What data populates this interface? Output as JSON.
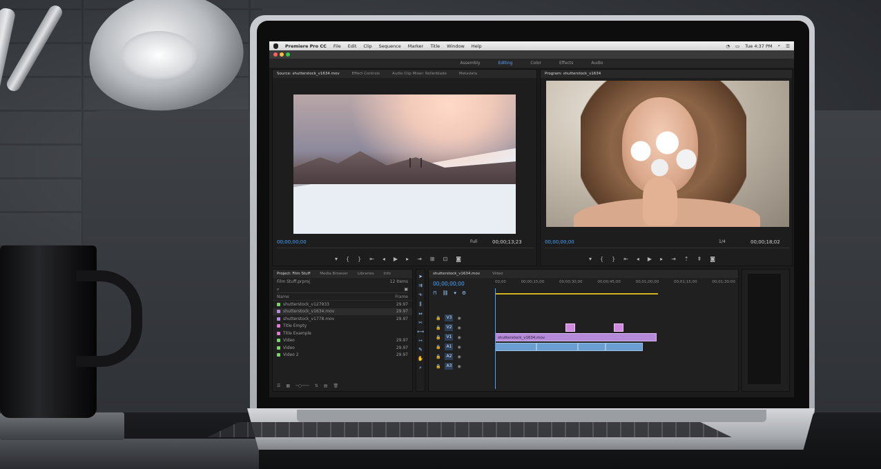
{
  "menubar": {
    "app": "Premiere Pro CC",
    "items": [
      "File",
      "Edit",
      "Clip",
      "Sequence",
      "Marker",
      "Title",
      "Window",
      "Help"
    ],
    "clock": "Tue 4:37 PM"
  },
  "workspaces": {
    "items": [
      "Assembly",
      "Editing",
      "Color",
      "Effects",
      "Audio"
    ],
    "active": "Editing"
  },
  "source": {
    "tabs": [
      "Source: shutterstock_v1634.mov",
      "Effect Controls",
      "Audio Clip Mixer: Rollerblade",
      "Metadata"
    ],
    "timecode_in": "00;00;00;00",
    "fit": "Full",
    "timecode_dur": "00;00;13;23"
  },
  "program": {
    "tab": "Program: shutterstock_v1634",
    "timecode_in": "00;00;00;00",
    "fit": "1/4",
    "timecode_dur": "00;00;18;02"
  },
  "project": {
    "tabs": [
      "Project: Film Stuff",
      "Media Browser",
      "Libraries",
      "Info"
    ],
    "subtitle": "Film Stuff.prproj",
    "item_count": "12 Items",
    "head_name": "Name",
    "head_rate": "Frame",
    "items": [
      {
        "name": "shutterstock_v127933",
        "rate": "29.97",
        "color": "#7bd36a"
      },
      {
        "name": "shutterstock_v1634.mov",
        "rate": "29.97",
        "color": "#b58ad8"
      },
      {
        "name": "shutterstock_v1778.mov",
        "rate": "29.97",
        "color": "#b58ad8"
      },
      {
        "name": "Title Empty",
        "rate": "",
        "color": "#e07bd0"
      },
      {
        "name": "Title Example",
        "rate": "",
        "color": "#e07bd0"
      },
      {
        "name": "Video",
        "rate": "29.97",
        "color": "#7bd36a"
      },
      {
        "name": "Video",
        "rate": "29.97",
        "color": "#7bd36a"
      },
      {
        "name": "Video 2",
        "rate": "29.97",
        "color": "#7bd36a"
      }
    ]
  },
  "timeline": {
    "tabs": [
      "shutterstock_v1634.mov",
      "Video"
    ],
    "timecode": "00;00;00;00",
    "ruler": [
      "00;00",
      "00;00;15;00",
      "00;00;30;00",
      "00;00;45;00",
      "00;01;00;00",
      "00;01;15;00",
      "00;01;30;00"
    ],
    "tracks": [
      "V3",
      "V2",
      "V1",
      "A1",
      "A2",
      "A3"
    ],
    "clip_label": "shutterstock_v1634.mov"
  },
  "colors": {
    "accent": "#4aa3ff",
    "video_clip": "#b58ad8",
    "audio_clip": "#6b9fd1",
    "workbar": "#d2b320"
  }
}
